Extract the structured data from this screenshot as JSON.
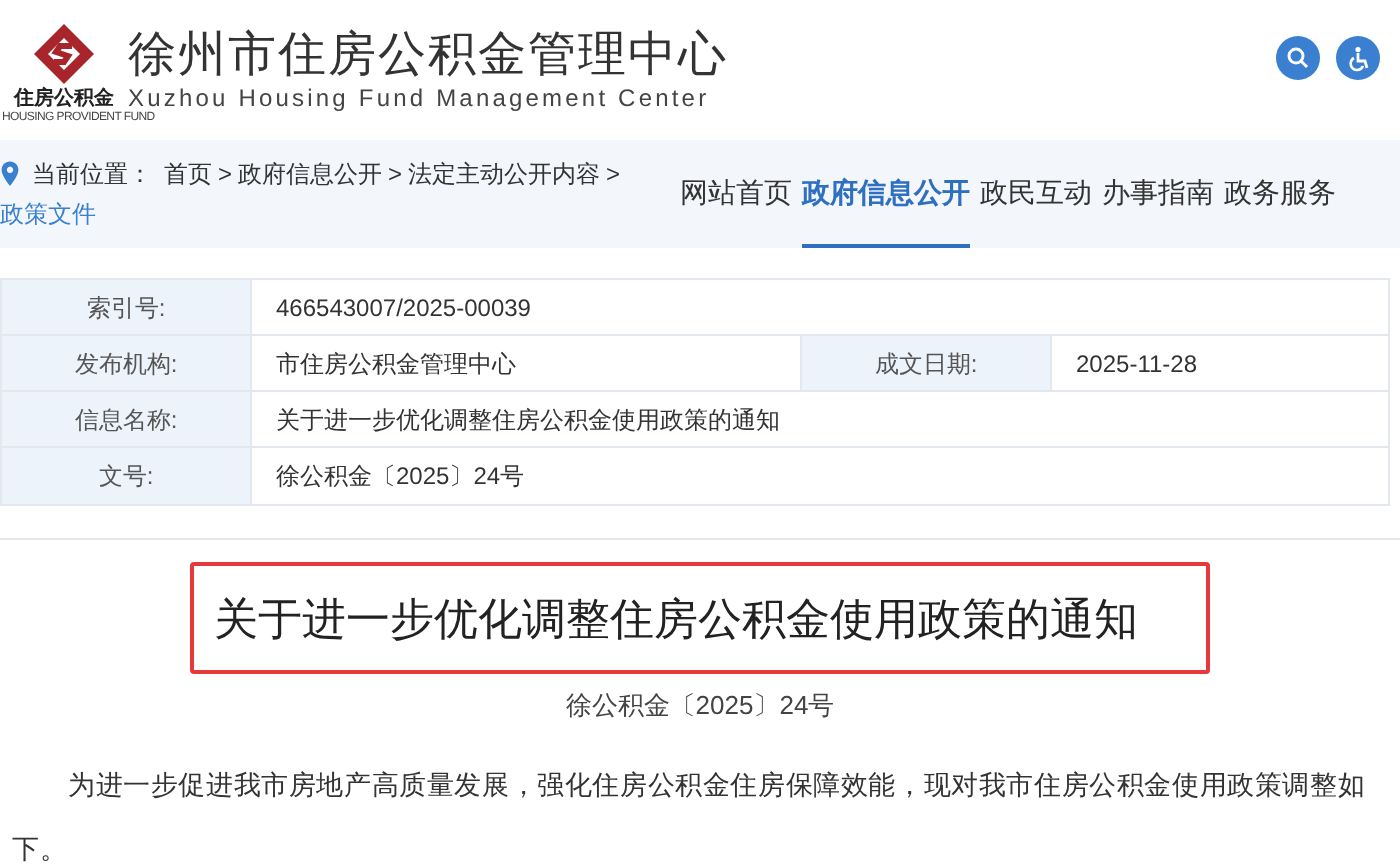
{
  "header": {
    "title": "徐州市住房公积金管理中心",
    "subtitle": "Xuzhou Housing Fund Management Center",
    "logo_text": "住房公积金",
    "logo_small": "HOUSING PROVIDENT FUND"
  },
  "breadcrumb": {
    "label": "当前位置：",
    "separator": ">",
    "items": [
      {
        "label": "首页",
        "current": false
      },
      {
        "label": "政府信息公开",
        "current": false
      },
      {
        "label": "法定主动公开内容",
        "current": false
      },
      {
        "label": "政策文件",
        "current": true
      }
    ]
  },
  "nav": [
    {
      "label": "网站首页",
      "selected": false
    },
    {
      "label": "政府信息公开",
      "selected": true
    },
    {
      "label": "政民互动",
      "selected": false
    },
    {
      "label": "办事指南",
      "selected": false
    },
    {
      "label": "政务服务",
      "selected": false
    }
  ],
  "info_table": [
    [
      {
        "label": "索引号:",
        "value": "466543007/2025-00039"
      }
    ],
    [
      {
        "label": "发布机构:",
        "value": "市住房公积金管理中心"
      },
      {
        "label": "成文日期:",
        "value": "2025-11-28"
      }
    ],
    [
      {
        "label": "信息名称:",
        "value": "关于进一步优化调整住房公积金使用政策的通知"
      }
    ],
    [
      {
        "label": "文号:",
        "value": "徐公积金〔2025〕24号"
      }
    ]
  ],
  "article": {
    "title": "关于进一步优化调整住房公积金使用政策的通知",
    "title_highlighted": true,
    "doc_number": "徐公积金〔2025〕24号",
    "paragraph": "为进一步促进我市房地产高质量发展，强化住房公积金住房保障效能，现对我市住房公积金使用政策调整如下。"
  }
}
